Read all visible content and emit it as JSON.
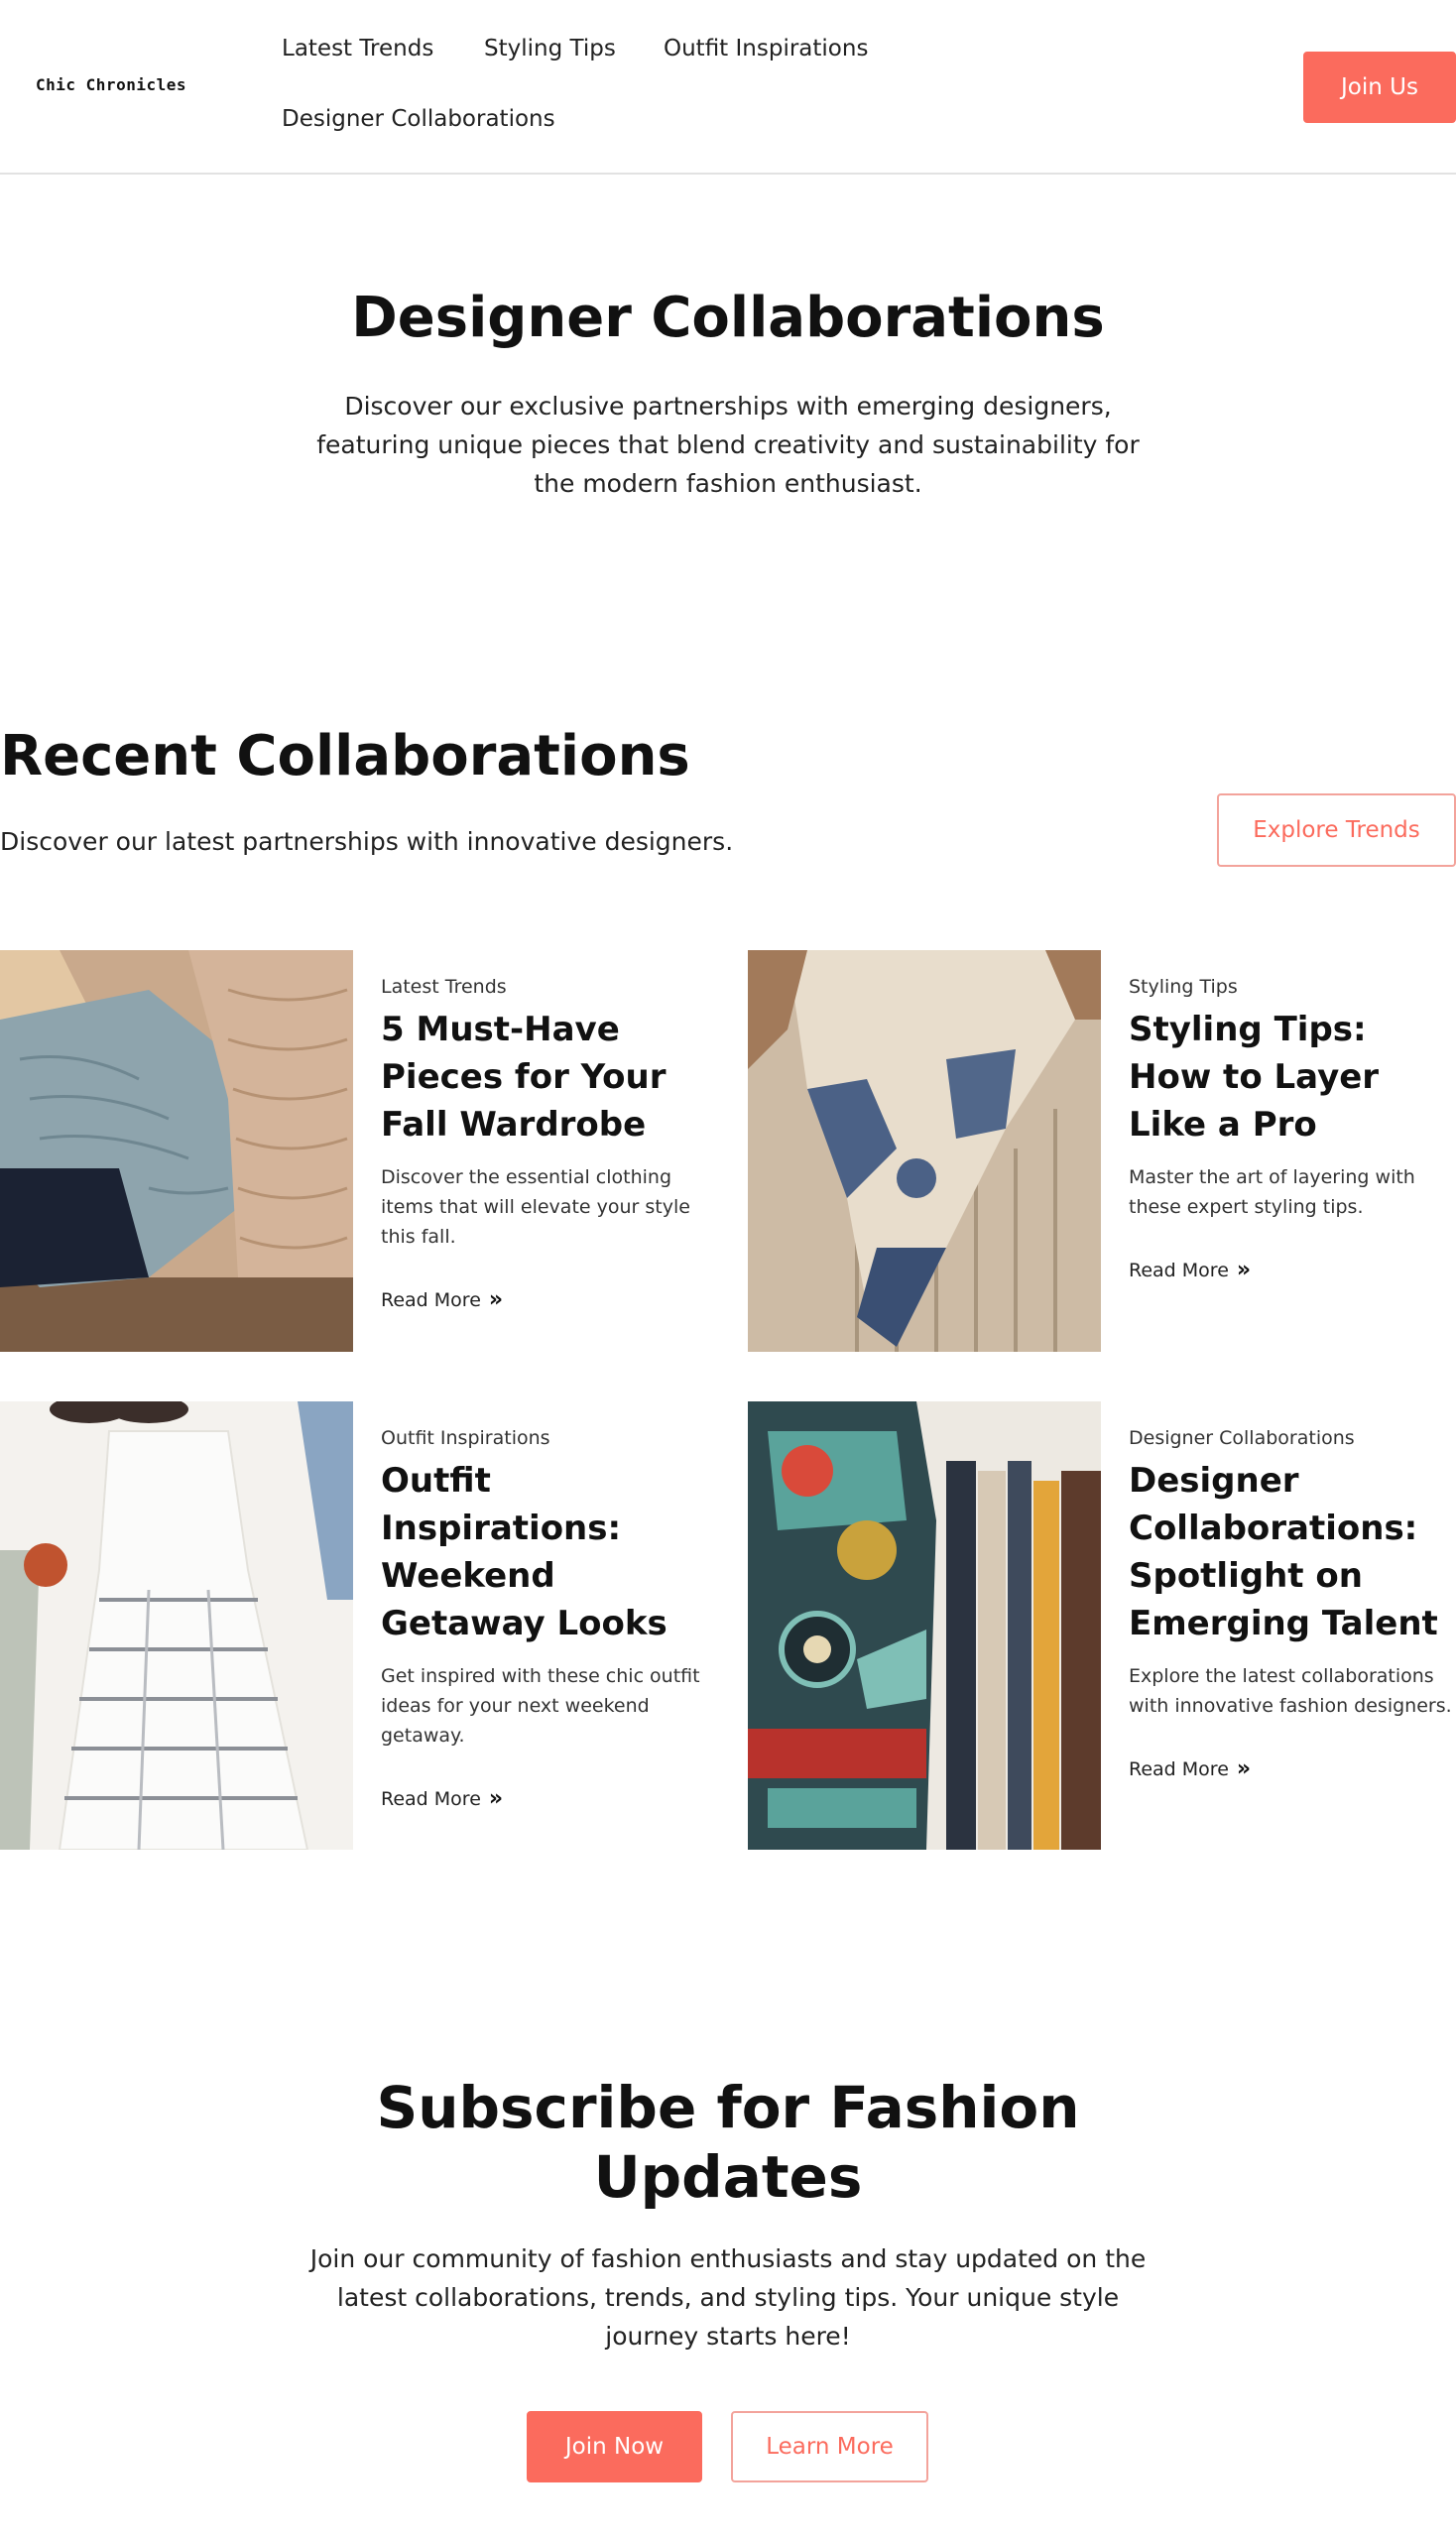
{
  "header": {
    "logo": "Chic Chronicles",
    "nav": [
      "Latest Trends",
      "Styling Tips",
      "Outfit Inspirations",
      "Designer Collaborations"
    ],
    "cta": "Join Us"
  },
  "hero": {
    "title": "Designer Collaborations",
    "subtitle": "Discover our exclusive partnerships with emerging designers, featuring unique pieces that blend creativity and sustainability for the modern fashion enthusiast."
  },
  "recent": {
    "title": "Recent Collaborations",
    "subtitle": "Discover our latest partnerships with innovative designers.",
    "button": "Explore Trends"
  },
  "cards": [
    {
      "category": "Latest Trends",
      "title": "5 Must-Have Pieces for Your Fall Wardrobe",
      "description": "Discover the essential clothing items that will elevate your style this fall.",
      "link": "Read More",
      "image": "knit-sweaters-image"
    },
    {
      "category": "Styling Tips",
      "title": "Styling Tips: How to Layer Like a Pro",
      "description": "Master the art of layering with these expert styling tips.",
      "link": "Read More",
      "image": "scarf-sweater-image"
    },
    {
      "category": "Outfit Inspirations",
      "title": "Outfit Inspirations: Weekend Getaway Looks",
      "description": "Get inspired with these chic outfit ideas for your next weekend getaway.",
      "link": "Read More",
      "image": "striped-dress-image"
    },
    {
      "category": "Designer Collaborations",
      "title": "Designer Collaborations: Spotlight on Emerging Talent",
      "description": "Explore the latest collaborations with innovative fashion designers.",
      "link": "Read More",
      "image": "patterned-dress-image"
    }
  ],
  "subscribe": {
    "title": "Subscribe for Fashion Updates",
    "text": "Join our community of fashion enthusiasts and stay updated on the latest collaborations, trends, and styling tips. Your unique style journey starts here!",
    "primary": "Join Now",
    "secondary": "Learn More"
  },
  "colors": {
    "accent": "#fb6b5d",
    "outline": "#f3a39b",
    "text": "#111111"
  }
}
